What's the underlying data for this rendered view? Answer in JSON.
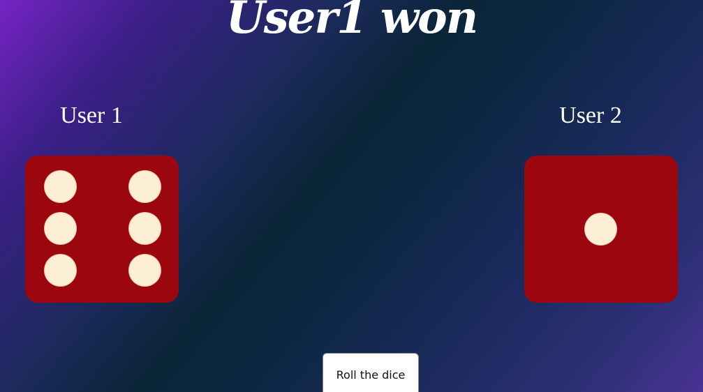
{
  "game": {
    "result_title": "User1 won"
  },
  "players": [
    {
      "label": "User 1",
      "die_value": 6
    },
    {
      "label": "User 2",
      "die_value": 1
    }
  ],
  "controls": {
    "roll_label": "Roll the dice"
  },
  "colors": {
    "die_face": "#9c060e",
    "pip": "#fbeed4",
    "title_text": "#ffffff"
  }
}
